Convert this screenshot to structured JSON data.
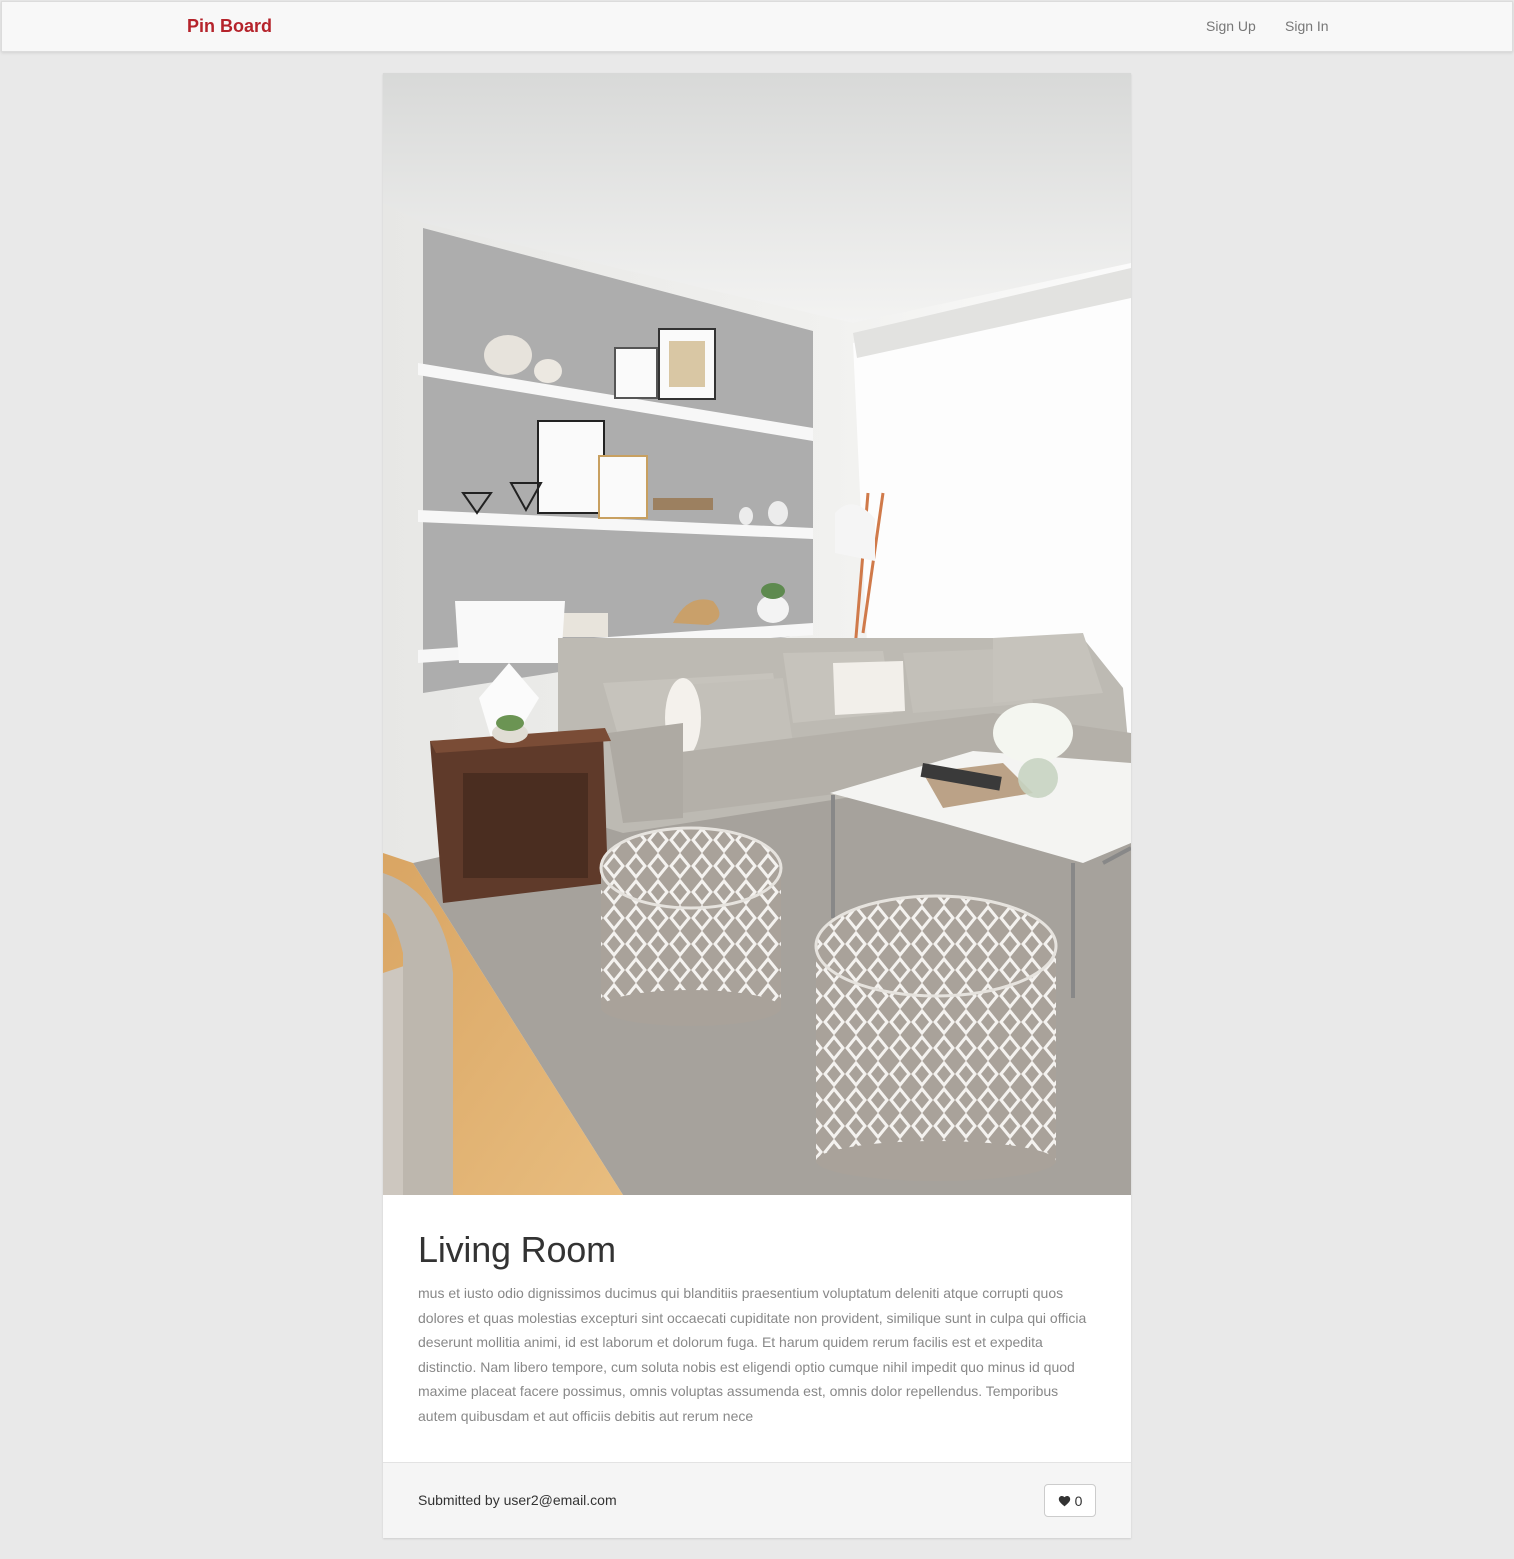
{
  "navbar": {
    "brand": "Pin Board",
    "links": [
      "Sign Up",
      "Sign In"
    ]
  },
  "pin": {
    "image_icon": "living-room-photo",
    "title": "Living Room",
    "description": "mus et iusto odio dignissimos ducimus qui blanditiis praesentium voluptatum deleniti atque corrupti quos dolores et quas molestias excepturi sint occaecati cupiditate non provident, similique sunt in culpa qui officia deserunt mollitia animi, id est laborum et dolorum fuga. Et harum quidem rerum facilis est et expedita distinctio. Nam libero tempore, cum soluta nobis est eligendi optio cumque nihil impedit quo minus id quod maxime placeat facere possimus, omnis voluptas assumenda est, omnis dolor repellendus. Temporibus autem quibusdam et aut officiis debitis aut rerum nece",
    "submitted_by": "Submitted by user2@email.com",
    "like_icon": "heart-icon",
    "likes": "0"
  },
  "colors": {
    "brand": "#b5232b",
    "page_background": "#e9e9e9",
    "navbar_background": "#f8f8f8",
    "footer_background": "#f5f5f5"
  }
}
